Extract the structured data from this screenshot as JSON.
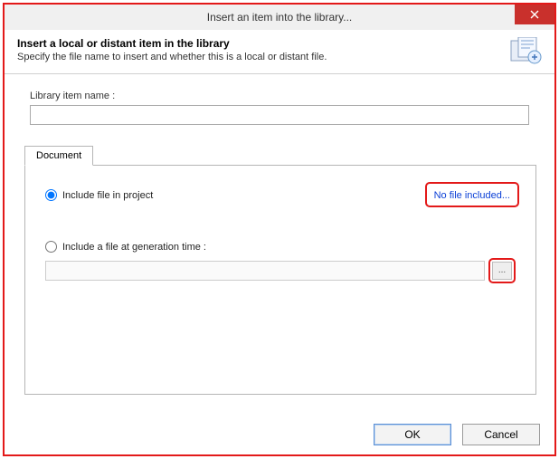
{
  "titlebar": {
    "text": "Insert an item into the library..."
  },
  "header": {
    "title": "Insert a local or distant item in the library",
    "subtitle": "Specify the file name to insert and whether this is a local or distant file."
  },
  "form": {
    "name_label": "Library item name :",
    "name_value": ""
  },
  "tab": {
    "label": "Document"
  },
  "options": {
    "include_project": "Include file in project",
    "include_gen": "Include a file at generation time :",
    "no_file_link": "No file included...",
    "gen_path_value": "",
    "browse_label": "..."
  },
  "buttons": {
    "ok": "OK",
    "cancel": "Cancel"
  }
}
